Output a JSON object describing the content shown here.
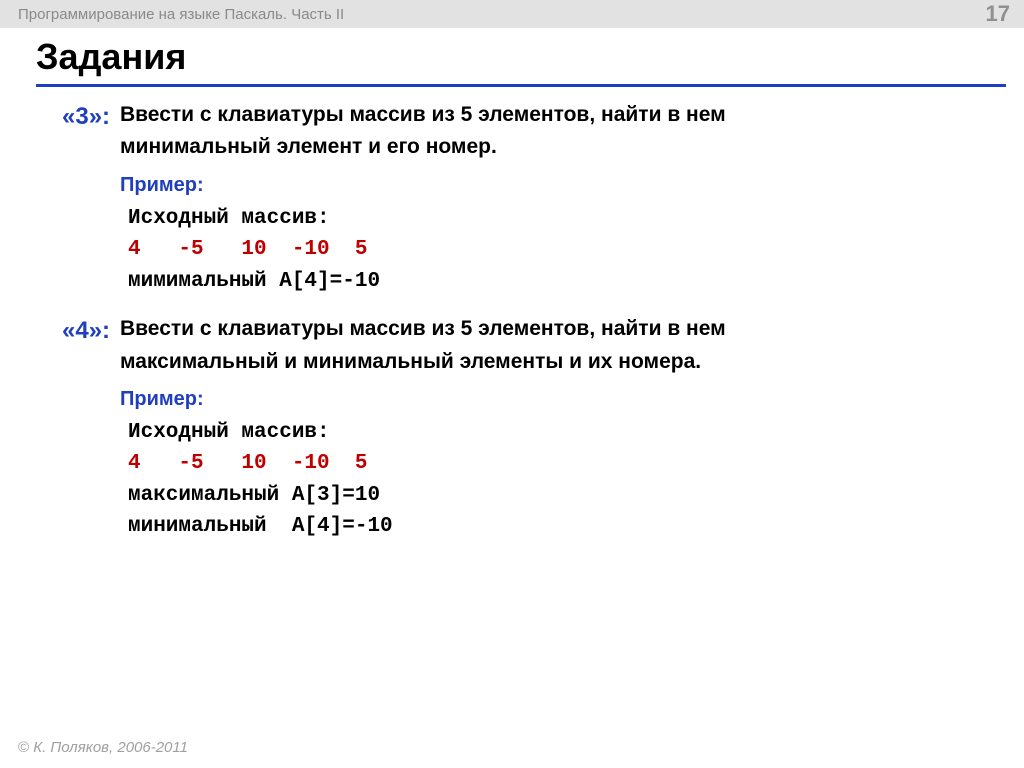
{
  "header": {
    "course": "Программирование на языке Паскаль. Часть II",
    "page_number": "17"
  },
  "title": "Задания",
  "tasks": [
    {
      "grade": "«3»:",
      "line1": "Ввести с клавиатуры массив из 5 элементов, найти в нем",
      "line2": "минимальный элемент и его номер.",
      "example_label": "Пример:",
      "code_label": "Исходный массив:",
      "code_values": "4   -5   10  -10  5",
      "code_result1": "мимимальный A[4]=-10"
    },
    {
      "grade": "«4»:",
      "line1": "Ввести с клавиатуры массив из 5 элементов, найти в нем",
      "line2": "максимальный и минимальный элементы и их номера.",
      "example_label": "Пример:",
      "code_label": "Исходный массив:",
      "code_values": "4   -5   10  -10  5",
      "code_result1": "максимальный A[3]=10",
      "code_result2": "минимальный  A[4]=-10"
    }
  ],
  "footer": {
    "copyright": "©",
    "author": " К. Поляков, 2006-2011"
  }
}
